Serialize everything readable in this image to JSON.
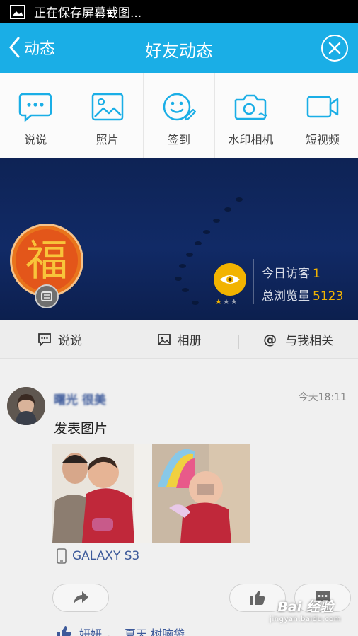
{
  "status_bar": {
    "text": "正在保存屏幕截图..."
  },
  "header": {
    "back_label": "动态",
    "title": "好友动态"
  },
  "actions": [
    {
      "label": "说说",
      "icon": "chat-bubble-icon"
    },
    {
      "label": "照片",
      "icon": "photo-icon"
    },
    {
      "label": "签到",
      "icon": "smiley-pen-icon"
    },
    {
      "label": "水印相机",
      "icon": "camera-icon"
    },
    {
      "label": "短视频",
      "icon": "video-camera-icon"
    }
  ],
  "profile": {
    "avatar_char": "福",
    "today_visitors_label": "今日访客",
    "today_visitors": "1",
    "total_views_label": "总浏览量",
    "total_views": "5123",
    "level_stars": 1,
    "level_max": 3
  },
  "tabs": [
    {
      "label": "说说"
    },
    {
      "label": "相册"
    },
    {
      "label": "与我相关",
      "symbol": "@"
    }
  ],
  "post": {
    "author": "曙光 很美",
    "time": "今天18:11",
    "text": "发表图片",
    "device": "GALAXY S3",
    "likes_a": "妍妍",
    "likes_b": "夏天 树脑袋"
  },
  "watermark": {
    "main": "Bai 经验",
    "sub": "jingyan.baidu.com"
  },
  "colors": {
    "title_bar": "#1aaee6",
    "accent_blue": "#1aaee6",
    "gold": "#f2b300",
    "link_blue": "#3d5a9a"
  }
}
